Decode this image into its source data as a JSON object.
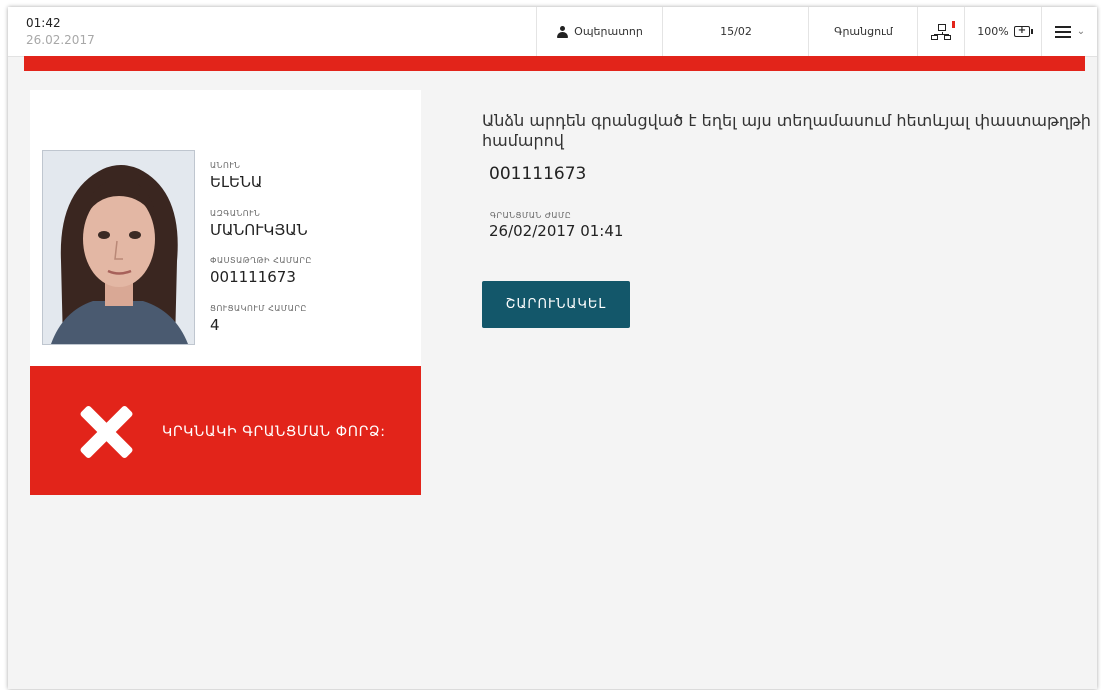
{
  "header": {
    "time": "01:42",
    "date": "26.02.2017",
    "operator_label": "Օպերատոր",
    "count": "15/02",
    "registration_label": "Գրանցում",
    "battery": "100%"
  },
  "card": {
    "name_label": "ԱՆՈՒՆ",
    "name": "ԵԼԵՆԱ",
    "surname_label": "ԱԶԳԱՆՈՒՆ",
    "surname": "ՄԱՆՈՒԿՅԱՆ",
    "passport_label": "ՓԱՍՏԱԹՂԹԻ ՀԱՄԱՐԸ",
    "passport_number": "001111673",
    "list_number_label": "ՑՈՒՑԱԿՈՒՄ ՀԱՄԱՐԸ",
    "list_number": "4",
    "error_message": "ԿՐԿՆԱԿԻ ԳՐԱՆՑՄԱՆ ՓՈՐՁ:"
  },
  "info": {
    "message": "Անձն արդեն գրանցված է եղել այս տեղամասում հետևյալ փաստաթղթի համարով",
    "document_number": "001111673",
    "registration_time_label": "ԳՐԱՆՑՄԱՆ ԺԱՄԸ",
    "registration_time": "26/02/2017 01:41",
    "continue_button": "ՇԱՐՈՒՆԱԿԵԼ"
  },
  "colors": {
    "alert_red": "#e2241a",
    "button_teal": "#13576a"
  },
  "icons": [
    "user-icon",
    "network-alert-icon",
    "battery-icon",
    "menu-icon",
    "chevron-down-icon",
    "close-x-icon"
  ]
}
